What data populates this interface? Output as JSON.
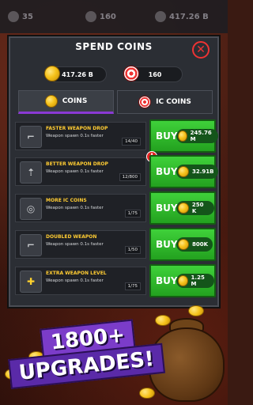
{
  "topbar": {
    "stat1": "35",
    "stat2": "160",
    "stat3": "417.26 B"
  },
  "panel": {
    "title": "SPEND COINS",
    "balances": {
      "coins": "417.26 B",
      "ic": "160"
    },
    "tabs": [
      {
        "label": "COINS",
        "icon": "coin-icon",
        "active": true
      },
      {
        "label": "IC COINS",
        "icon": "target-icon",
        "active": false
      }
    ]
  },
  "upgrades": [
    {
      "name": "FASTER WEAPON DROP",
      "desc": "Weapon spawn 0.1s faster",
      "progress": "14/40",
      "buy": "BUY",
      "price": "245.76 M",
      "icon": "pistol-icon",
      "alert": false
    },
    {
      "name": "BETTER WEAPON DROP",
      "desc": "Weapon spawn 0.1s faster",
      "progress": "12/800",
      "buy": "BUY",
      "price": "32.91B",
      "icon": "upgrade-pistol-icon",
      "alert": true
    },
    {
      "name": "MORE IC COINS",
      "desc": "Weapon spawn 0.1s faster",
      "progress": "1/75",
      "buy": "BUY",
      "price": "250 K",
      "icon": "target-coins-icon",
      "alert": false
    },
    {
      "name": "DOUBLED WEAPON",
      "desc": "Weapon spawn 0.1s faster",
      "progress": "1/50",
      "buy": "BUY",
      "price": "800K",
      "icon": "double-pistol-icon",
      "alert": false
    },
    {
      "name": "EXTRA WEAPON LEVEL",
      "desc": "Weapon spawn 0.1s faster",
      "progress": "1/75",
      "buy": "BUY",
      "price": "1.25 M",
      "icon": "plus-icon",
      "alert": false
    }
  ],
  "promo": {
    "line1": "1800+",
    "line2": "UPGRADES!"
  },
  "colors": {
    "buy_green": "#2fb82a",
    "accent_purple": "#7b3cc9",
    "title_yellow": "#ffcc33",
    "close_red": "#e33333"
  }
}
